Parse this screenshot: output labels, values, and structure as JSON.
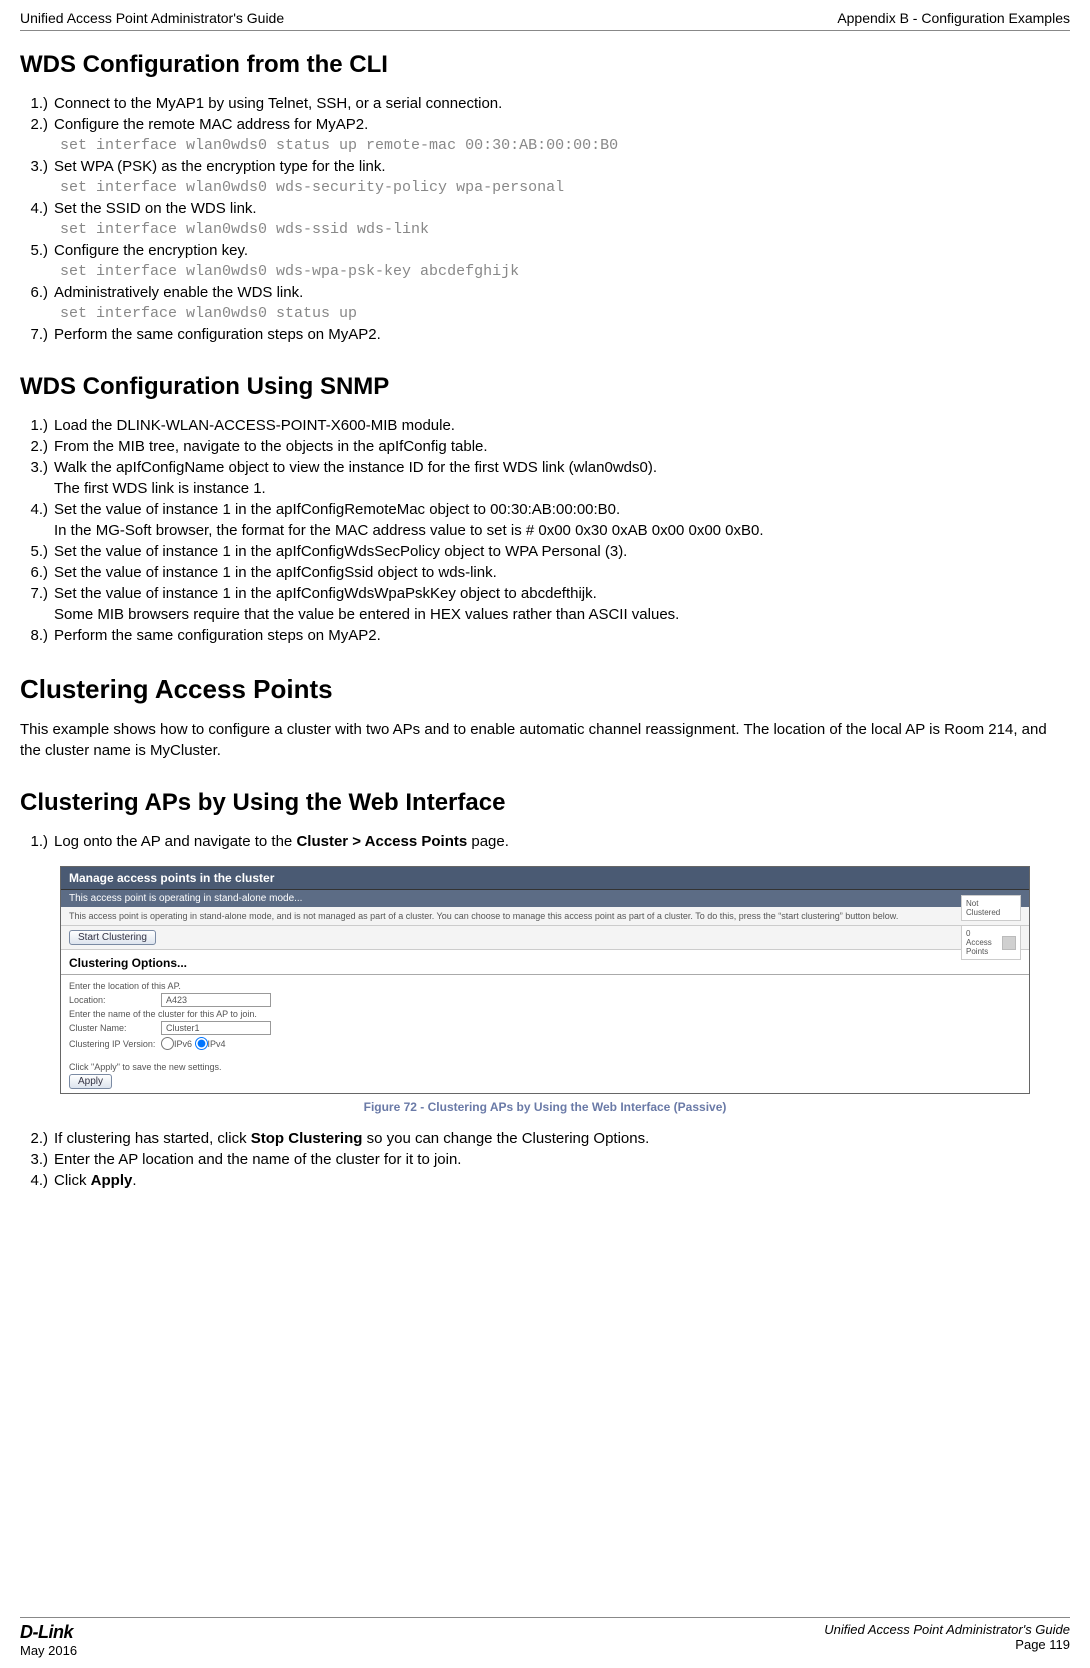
{
  "header": {
    "left": "Unified Access Point Administrator's Guide",
    "right": "Appendix B - Configuration Examples"
  },
  "footer": {
    "brand": "D-Link",
    "date": "May 2016",
    "guide": "Unified Access Point Administrator's Guide",
    "page": "Page 119"
  },
  "s1": {
    "title": "WDS Configuration from the CLI",
    "steps": [
      {
        "n": "1.)",
        "t": "Connect to the MyAP1 by using Telnet, SSH, or a serial connection."
      },
      {
        "n": "2.)",
        "t": "Configure the remote MAC address for MyAP2.",
        "c": "set interface wlan0wds0 status up remote-mac 00:30:AB:00:00:B0"
      },
      {
        "n": "3.)",
        "t": "Set WPA (PSK) as the encryption type for the link.",
        "c": "set interface wlan0wds0 wds-security-policy wpa-personal"
      },
      {
        "n": "4.)",
        "t": "Set the SSID on the WDS link.",
        "c": "set interface wlan0wds0 wds-ssid wds-link"
      },
      {
        "n": "5.)",
        "t": "Configure the encryption key.",
        "c": "set interface wlan0wds0 wds-wpa-psk-key abcdefghijk"
      },
      {
        "n": "6.)",
        "t": "Administratively enable the WDS link.",
        "c": "set interface wlan0wds0 status up"
      },
      {
        "n": "7.)",
        "t": "Perform the same configuration steps on MyAP2."
      }
    ]
  },
  "s2": {
    "title": "WDS Configuration Using SNMP",
    "steps": [
      {
        "n": "1.)",
        "t": "Load the DLINK-WLAN-ACCESS-POINT-X600-MIB module."
      },
      {
        "n": "2.)",
        "t": "From the MIB tree, navigate to the objects in the apIfConfig table."
      },
      {
        "n": "3.)",
        "t": "Walk the apIfConfigName object to view the instance ID for the first WDS link (wlan0wds0).",
        "t2": "The first WDS link is instance 1."
      },
      {
        "n": "4.)",
        "t": "Set the value of instance 1 in the apIfConfigRemoteMac object to 00:30:AB:00:00:B0.",
        "t2": "In the MG-Soft browser, the format for the MAC address value to set is # 0x00 0x30 0xAB 0x00 0x00 0xB0."
      },
      {
        "n": "5.)",
        "t": "Set the value of instance 1 in the apIfConfigWdsSecPolicy object to WPA Personal (3)."
      },
      {
        "n": "6.)",
        "t": "Set the value of instance 1 in the apIfConfigSsid object to wds-link."
      },
      {
        "n": "7.)",
        "t": "Set the value of instance 1 in the apIfConfigWdsWpaPskKey object to abcdefthijk.",
        "t2": "Some MIB browsers require that the value be entered in HEX values rather than ASCII values."
      },
      {
        "n": "8.)",
        "t": "Perform the same configuration steps on MyAP2."
      }
    ]
  },
  "s3": {
    "title": "Clustering Access Points",
    "para": "This example shows how to configure a cluster with two APs and to enable automatic channel reassignment. The location of the local AP is Room 214, and the cluster name is MyCluster."
  },
  "s4": {
    "title": "Clustering APs by Using the Web Interface",
    "step1n": "1.)",
    "step1a": "Log onto the AP and navigate to the ",
    "step1b": "Cluster > Access Points",
    "step1c": " page.",
    "caption": "Figure 72 - Clustering APs by Using the Web Interface (Passive)",
    "step2n": "2.)",
    "step2a": "If clustering has started, click ",
    "step2b": "Stop Clustering",
    "step2c": " so you can change the Clustering Options.",
    "step3n": "3.)",
    "step3": "Enter the AP location and the name of the cluster for it to join.",
    "step4n": "4.)",
    "step4a": "Click ",
    "step4b": "Apply",
    "step4c": "."
  },
  "ui": {
    "title": "Manage access points in the cluster",
    "sub": "This access point is operating in stand-alone mode...",
    "desc": "This access point is operating in stand-alone mode, and is not managed as part of a cluster. You can choose to manage this access point as part of a cluster. To do this, press the “start clustering” button below.",
    "start": "Start Clustering",
    "opts": "Clustering Options...",
    "locprompt": "Enter the location of this AP.",
    "loclabel": "Location:",
    "locval": "A423",
    "cnprompt": "Enter the name of the cluster for this AP to join.",
    "cnlabel": "Cluster Name:",
    "cnval": "Cluster1",
    "verlabel": "Clustering IP Version:",
    "ipv6": "IPv6",
    "ipv4": "IPv4",
    "applynote": "Click \"Apply\" to save the new settings.",
    "apply": "Apply",
    "side1a": "Not",
    "side1b": "Clustered",
    "side2a": "0",
    "side2b": "Access",
    "side2c": "Points"
  }
}
